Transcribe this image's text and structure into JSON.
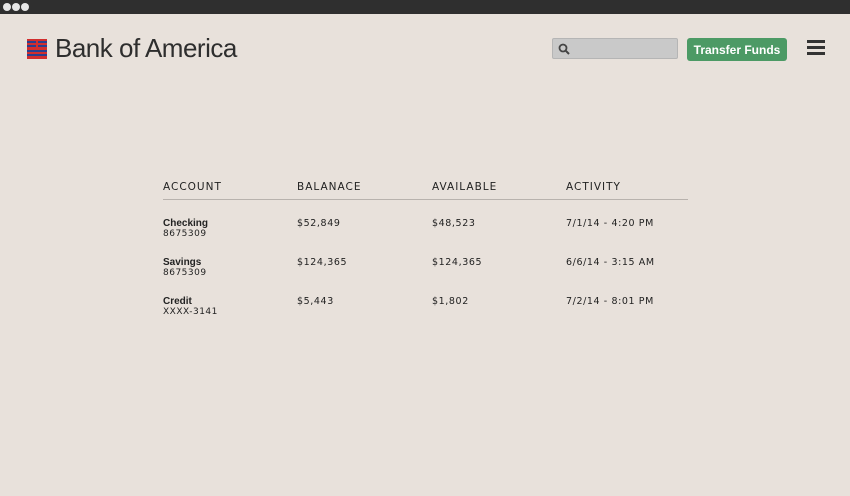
{
  "brand": {
    "name": "Bank of America"
  },
  "header": {
    "search_placeholder": "",
    "transfer_label": "Transfer Funds"
  },
  "table": {
    "headers": [
      "ACCOUNT",
      "BALANACE",
      "AVAILABLE",
      "ACTIVITY"
    ],
    "rows": [
      {
        "name": "Checking",
        "number": "8675309",
        "balance": "$52,849",
        "available": "$48,523",
        "activity": "7/1/14 - 4:20 PM"
      },
      {
        "name": "Savings",
        "number": "8675309",
        "balance": "$124,365",
        "available": "$124,365",
        "activity": "6/6/14 - 3:15 AM"
      },
      {
        "name": "Credit",
        "number": "XXXX-3141",
        "balance": "$5,443",
        "available": "$1,802",
        "activity": "7/2/14 - 8:01 PM"
      }
    ]
  },
  "colors": {
    "background": "#e8e1db",
    "titlebar": "#2f2f2f",
    "accent_green": "#4c9a65",
    "flag_red": "#d12e2e",
    "flag_blue": "#2a3f8f"
  },
  "icons": [
    "window-dot",
    "flag-logo-icon",
    "search-icon",
    "hamburger-menu-icon"
  ]
}
